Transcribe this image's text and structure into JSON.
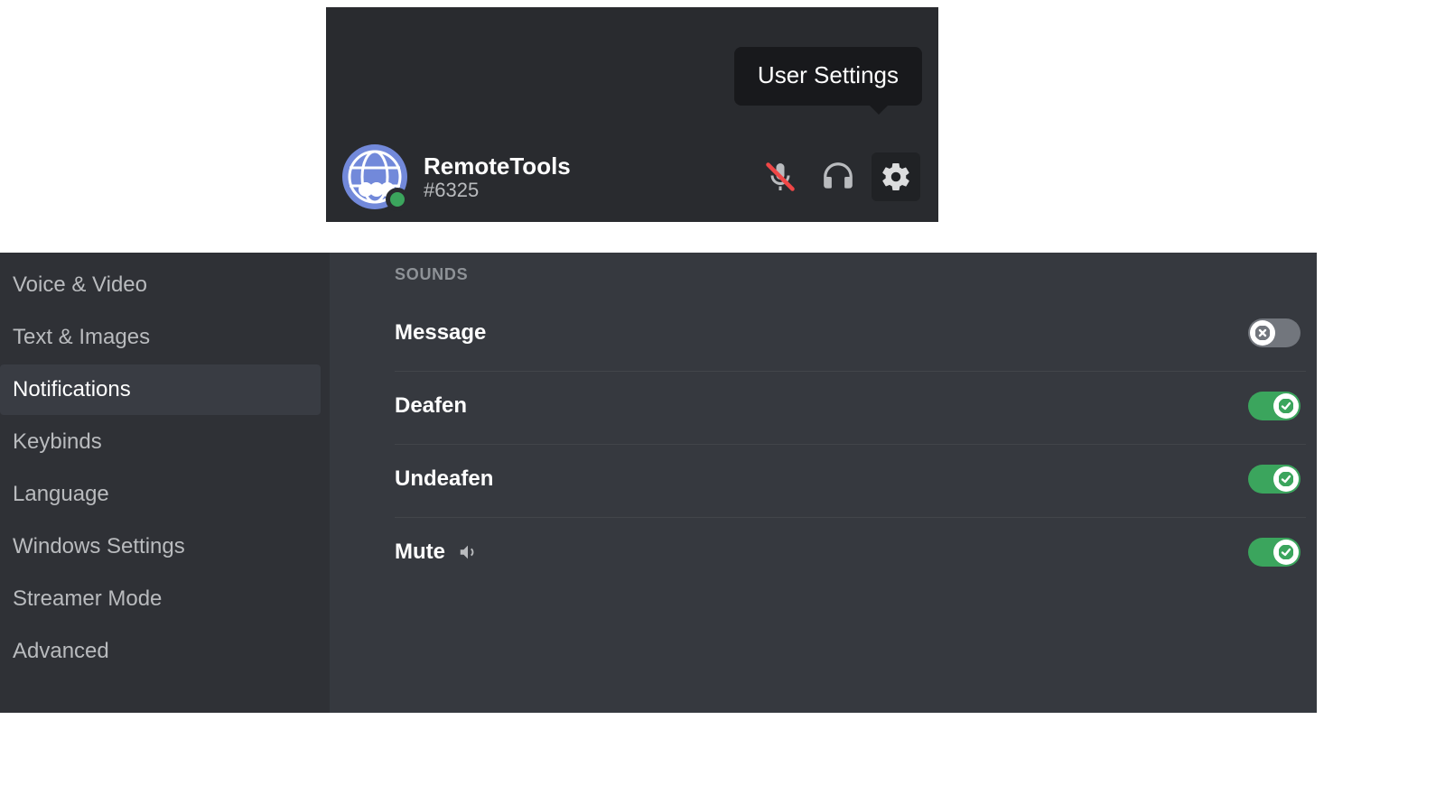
{
  "user_panel": {
    "username": "RemoteTools",
    "discriminator": "#6325",
    "tooltip": "User Settings"
  },
  "sidebar": {
    "items": [
      {
        "label": "Voice & Video"
      },
      {
        "label": "Text & Images"
      },
      {
        "label": "Notifications"
      },
      {
        "label": "Keybinds"
      },
      {
        "label": "Language"
      },
      {
        "label": "Windows Settings"
      },
      {
        "label": "Streamer Mode"
      },
      {
        "label": "Advanced"
      }
    ],
    "selected_index": 2
  },
  "content": {
    "section_header": "SOUNDS",
    "sounds": [
      {
        "label": "Message",
        "enabled": false,
        "has_preview": false
      },
      {
        "label": "Deafen",
        "enabled": true,
        "has_preview": false
      },
      {
        "label": "Undeafen",
        "enabled": true,
        "has_preview": false
      },
      {
        "label": "Mute",
        "enabled": true,
        "has_preview": true
      }
    ]
  }
}
